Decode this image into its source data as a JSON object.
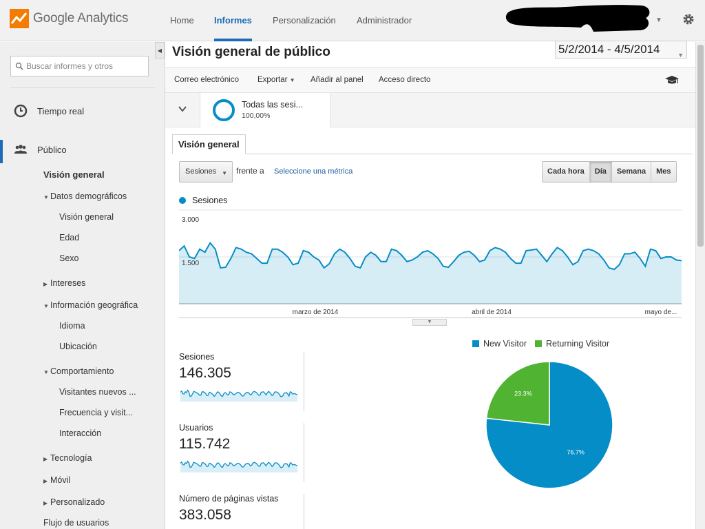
{
  "brand": {
    "name_google": "Google",
    "name_product": "Analytics",
    "colors": {
      "accent": "#1c6bb8",
      "series": "#058dc7",
      "returning": "#50b432"
    }
  },
  "topnav": {
    "home": "Home",
    "reports": "Informes",
    "customization": "Personalización",
    "admin": "Administrador"
  },
  "sidebar": {
    "search_placeholder": "Buscar informes y otros",
    "realtime": "Tiempo real",
    "audience": "Público",
    "overview": "Visión general",
    "demographics": "Datos demográficos",
    "demo_overview": "Visión general",
    "age": "Edad",
    "gender": "Sexo",
    "interests": "Intereses",
    "geo": "Información geográfica",
    "language": "Idioma",
    "location": "Ubicación",
    "behavior": "Comportamiento",
    "new_vs_returning": "Visitantes nuevos ...",
    "frequency": "Frecuencia y visit...",
    "engagement": "Interacción",
    "technology": "Tecnología",
    "mobile": "Móvil",
    "custom": "Personalizado",
    "users_flow": "Flujo de usuarios"
  },
  "report": {
    "title": "Visión general de público",
    "date_range": "5/2/2014 - 4/5/2014",
    "toolbar": {
      "email": "Correo electrónico",
      "export": "Exportar",
      "add_dashboard": "Añadir al panel",
      "shortcut": "Acceso directo"
    },
    "segment": {
      "name": "Todas las sesi...",
      "percent": "100,00%"
    },
    "tab": "Visión general",
    "metric_select": "Sesiones",
    "vs_text": "frente a",
    "select_metric_link": "Seleccione una métrica",
    "time_buttons": [
      "Cada hora",
      "Día",
      "Semana",
      "Mes"
    ],
    "time_active": "Día"
  },
  "chart_data": [
    {
      "type": "area",
      "series": [
        {
          "name": "Sesiones",
          "values": [
            1700,
            1850,
            1500,
            1450,
            1750,
            1650,
            1950,
            1750,
            1150,
            1170,
            1450,
            1800,
            1750,
            1650,
            1600,
            1450,
            1300,
            1300,
            1750,
            1750,
            1650,
            1500,
            1250,
            1300,
            1700,
            1650,
            1500,
            1400,
            1150,
            1280,
            1600,
            1750,
            1650,
            1450,
            1200,
            1150,
            1500,
            1650,
            1550,
            1350,
            1350,
            1750,
            1700,
            1550,
            1350,
            1400,
            1500,
            1650,
            1700,
            1600,
            1450,
            1200,
            1170,
            1350,
            1550,
            1650,
            1680,
            1550,
            1350,
            1400,
            1700,
            1800,
            1750,
            1650,
            1450,
            1300,
            1300,
            1700,
            1720,
            1750,
            1550,
            1350,
            1600,
            1800,
            1700,
            1500,
            1250,
            1350,
            1700,
            1750,
            1700,
            1600,
            1400,
            1150,
            1100,
            1250,
            1600,
            1600,
            1650,
            1450,
            1200,
            1750,
            1700,
            1450,
            1500,
            1500,
            1400,
            1380
          ],
          "color": "#058dc7"
        }
      ],
      "y_ticks": [
        "3.000",
        "1.500"
      ],
      "ylim": [
        0,
        3000
      ],
      "x_tick_labels": [
        "marzo de 2014",
        "abril de 2014",
        "mayo de..."
      ],
      "grid": true
    },
    {
      "type": "pie",
      "slices": [
        {
          "name": "New Visitor",
          "value": 76.7,
          "label": "76.7%",
          "color": "#058dc7"
        },
        {
          "name": "Returning Visitor",
          "value": 23.3,
          "label": "23.3%",
          "color": "#50b432"
        }
      ],
      "legend_position": "top"
    }
  ],
  "scorecards": [
    {
      "label": "Sesiones",
      "value": "146.305"
    },
    {
      "label": "Usuarios",
      "value": "115.742"
    },
    {
      "label": "Número de páginas vistas",
      "value": "383.058"
    }
  ]
}
